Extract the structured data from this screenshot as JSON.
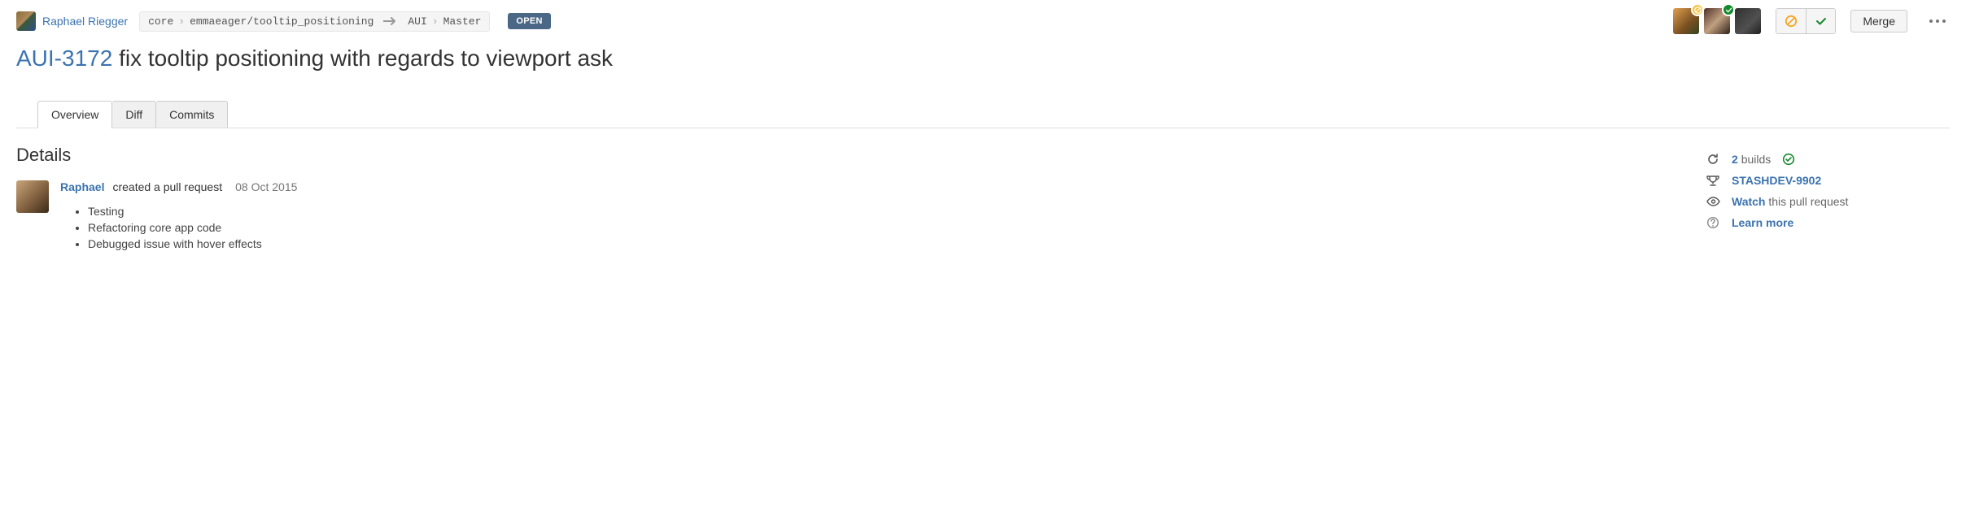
{
  "header": {
    "author_name": "Raphael Riegger",
    "source": {
      "repo": "core",
      "branch": "emmaeager/tooltip_positioning"
    },
    "target": {
      "repo": "AUI",
      "branch": "Master"
    },
    "status": "OPEN",
    "merge_label": "Merge",
    "reviewers": [
      {
        "status": "pending"
      },
      {
        "status": "approved"
      },
      {
        "status": "none"
      }
    ]
  },
  "title": {
    "issue_key": "AUI-3172",
    "summary": "fix tooltip positioning with regards to viewport ask"
  },
  "tabs": {
    "overview": "Overview",
    "diff": "Diff",
    "commits": "Commits"
  },
  "details": {
    "heading": "Details",
    "actor": "Raphael",
    "action": "created a pull request",
    "date": "08 Oct 2015",
    "bullets": [
      "Testing",
      "Refactoring core app code",
      "Debugged issue with hover effects"
    ]
  },
  "sidebar": {
    "builds": {
      "count": "2",
      "label": "builds"
    },
    "linked_issue": "STASHDEV-9902",
    "watch_strong": "Watch",
    "watch_rest": "this pull request",
    "learn_more": "Learn more"
  }
}
